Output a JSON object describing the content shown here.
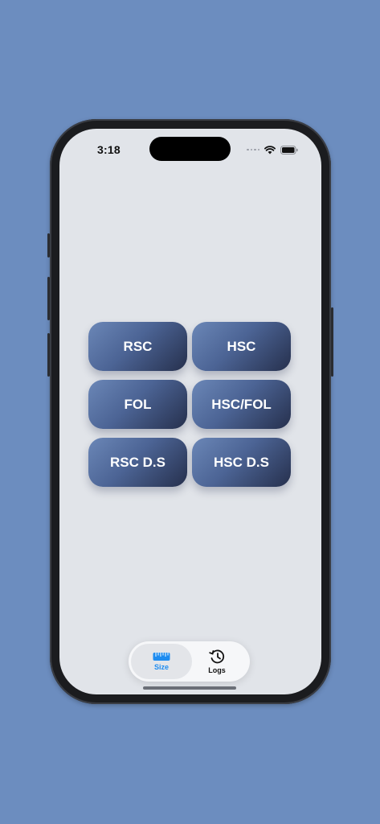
{
  "status_bar": {
    "time": "3:18"
  },
  "buttons": [
    {
      "label": "RSC",
      "name": "rsc-button"
    },
    {
      "label": "HSC",
      "name": "hsc-button"
    },
    {
      "label": "FOL",
      "name": "fol-button"
    },
    {
      "label": "HSC/FOL",
      "name": "hsc-fol-button"
    },
    {
      "label": "RSC D.S",
      "name": "rsc-ds-button"
    },
    {
      "label": "HSC D.S",
      "name": "hsc-ds-button"
    }
  ],
  "tabbar": {
    "tabs": [
      {
        "label": "Size",
        "icon": "ruler-icon",
        "selected": true,
        "color": "#1e8cf0"
      },
      {
        "label": "Logs",
        "icon": "history-clock-icon",
        "selected": false,
        "color": "#111111"
      }
    ]
  },
  "colors": {
    "background": "#6c8dbf",
    "screen": "#e1e4e9",
    "button_gradient_start": "#6b87b7",
    "button_gradient_end": "#26304d",
    "accent": "#1e8cf0"
  }
}
